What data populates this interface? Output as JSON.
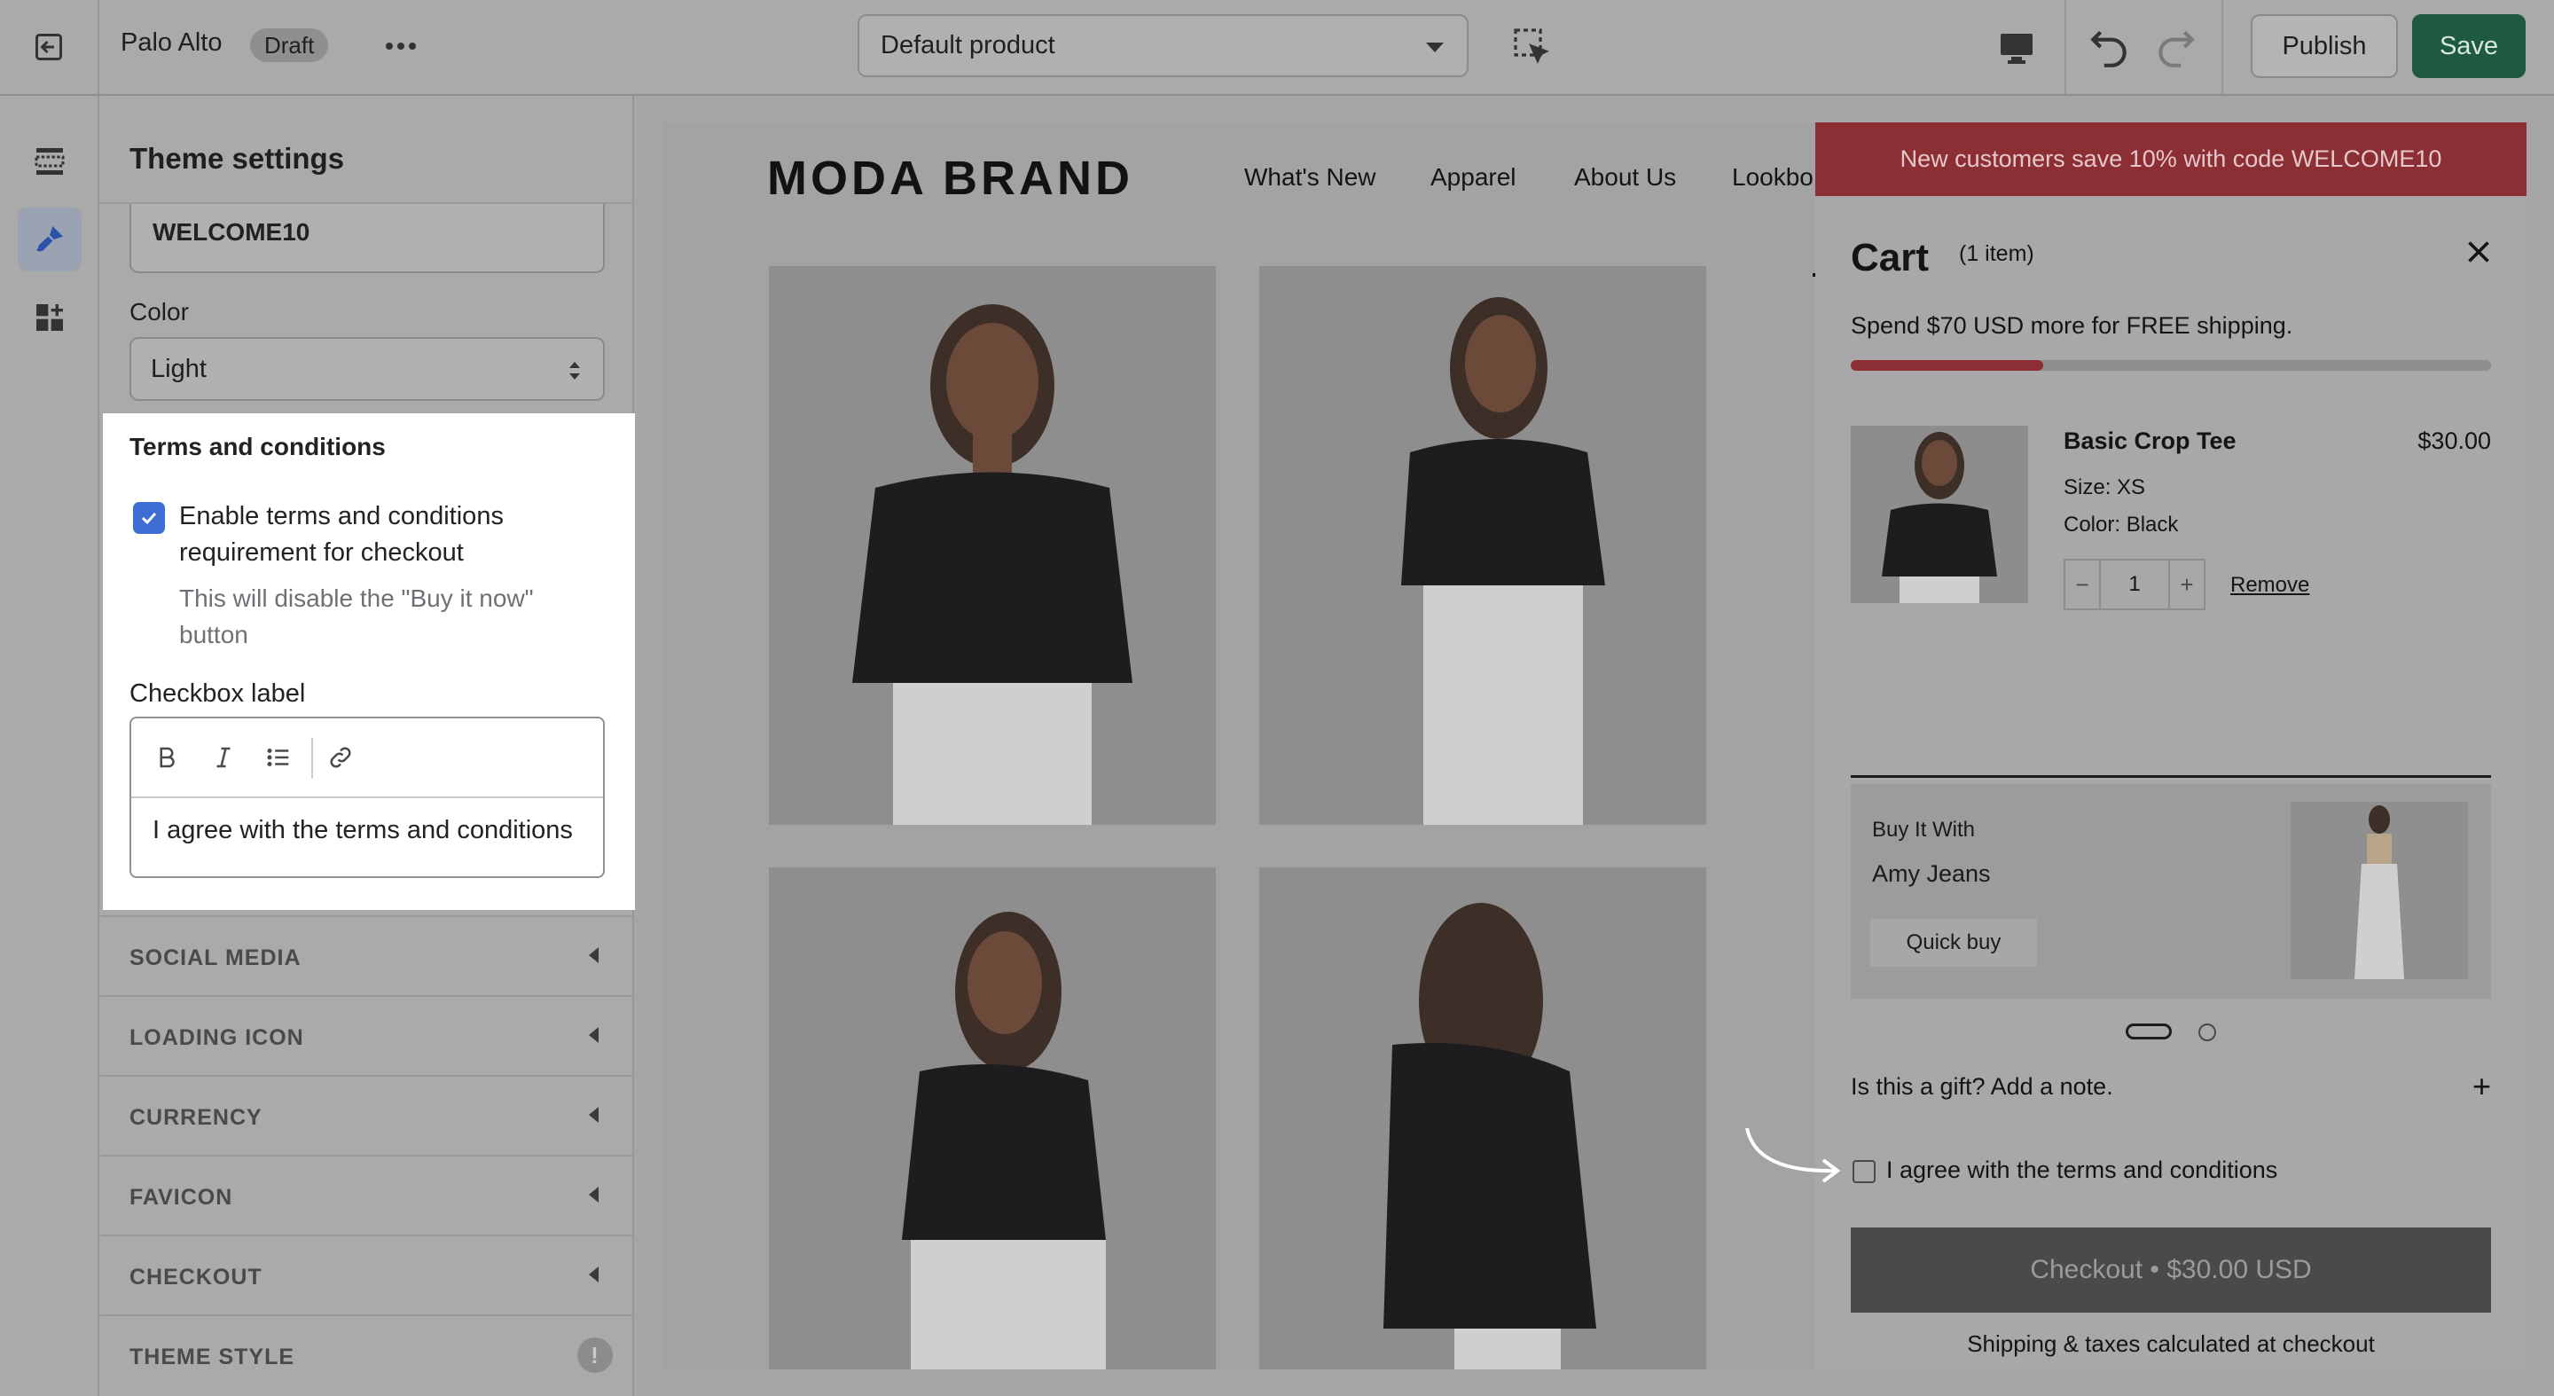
{
  "topbar": {
    "store_name": "Palo Alto",
    "status_badge": "Draft",
    "template_select": "Default product",
    "publish_label": "Publish",
    "save_label": "Save"
  },
  "sidebar": {
    "title": "Theme settings",
    "discount_code_value": "WELCOME10",
    "color_label": "Color",
    "color_value": "Light",
    "terms": {
      "heading": "Terms and conditions",
      "enable_label": "Enable terms and conditions requirement for checkout",
      "enable_checked": true,
      "help_text": "This will disable the \"Buy it now\" button",
      "checkbox_label_heading": "Checkbox label",
      "checkbox_label_value": "I agree with the terms and conditions"
    },
    "sections": [
      "SOCIAL MEDIA",
      "LOADING ICON",
      "CURRENCY",
      "FAVICON",
      "CHECKOUT",
      "THEME STYLE"
    ]
  },
  "preview": {
    "brand": "MODA BRAND",
    "nav": [
      "What's New",
      "Apparel",
      "About Us",
      "Lookbo"
    ]
  },
  "cart": {
    "promo": "New customers save 10% with code WELCOME10",
    "title": "Cart",
    "count": "(1 item)",
    "shipping_msg": "Spend $70 USD more for FREE shipping.",
    "shipping_progress": 0.3,
    "item": {
      "name": "Basic Crop Tee",
      "price": "$30.00",
      "size": "Size: XS",
      "color": "Color: Black",
      "quantity": "1",
      "remove": "Remove"
    },
    "upsell": {
      "heading": "Buy It With",
      "product": "Amy Jeans",
      "button": "Quick buy"
    },
    "gift_note": "Is this a gift? Add a note.",
    "agree_label": "I agree with the terms and conditions",
    "checkout_label": "Checkout • $30.00 USD",
    "taxes_note": "Shipping & taxes calculated at checkout"
  },
  "colors": {
    "accent_blue": "#3b6dd3",
    "save_green": "#1d5a3f",
    "promo_red": "#8b2f35"
  }
}
